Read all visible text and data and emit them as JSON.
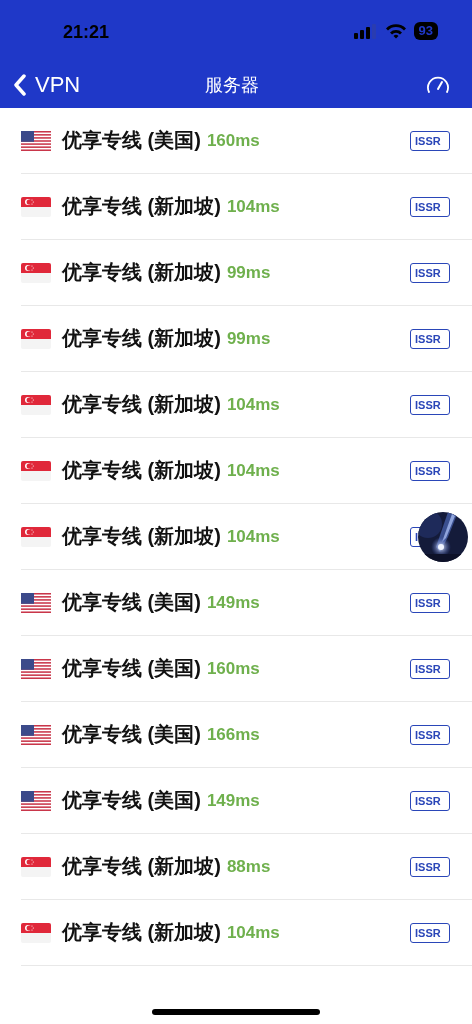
{
  "status_bar": {
    "time": "21:21",
    "battery": "93"
  },
  "nav": {
    "back_label": "VPN",
    "title": "服务器"
  },
  "servers": [
    {
      "kind": "us",
      "name": "优享专线 (美国)",
      "latency": "160ms",
      "protocol": "ISSR"
    },
    {
      "kind": "sg",
      "name": "优享专线 (新加坡)",
      "latency": "104ms",
      "protocol": "ISSR"
    },
    {
      "kind": "sg",
      "name": "优享专线 (新加坡)",
      "latency": "99ms",
      "protocol": "ISSR"
    },
    {
      "kind": "sg",
      "name": "优享专线 (新加坡)",
      "latency": "99ms",
      "protocol": "ISSR"
    },
    {
      "kind": "sg",
      "name": "优享专线 (新加坡)",
      "latency": "104ms",
      "protocol": "ISSR"
    },
    {
      "kind": "sg",
      "name": "优享专线 (新加坡)",
      "latency": "104ms",
      "protocol": "ISSR"
    },
    {
      "kind": "sg",
      "name": "优享专线 (新加坡)",
      "latency": "104ms",
      "protocol": "I"
    },
    {
      "kind": "us",
      "name": "优享专线 (美国)",
      "latency": "149ms",
      "protocol": "ISSR"
    },
    {
      "kind": "us",
      "name": "优享专线 (美国)",
      "latency": "160ms",
      "protocol": "ISSR"
    },
    {
      "kind": "us",
      "name": "优享专线 (美国)",
      "latency": "166ms",
      "protocol": "ISSR"
    },
    {
      "kind": "us",
      "name": "优享专线 (美国)",
      "latency": "149ms",
      "protocol": "ISSR"
    },
    {
      "kind": "sg",
      "name": "优享专线 (新加坡)",
      "latency": "88ms",
      "protocol": "ISSR"
    },
    {
      "kind": "sg",
      "name": "优享专线 (新加坡)",
      "latency": "104ms",
      "protocol": "ISSR"
    }
  ]
}
